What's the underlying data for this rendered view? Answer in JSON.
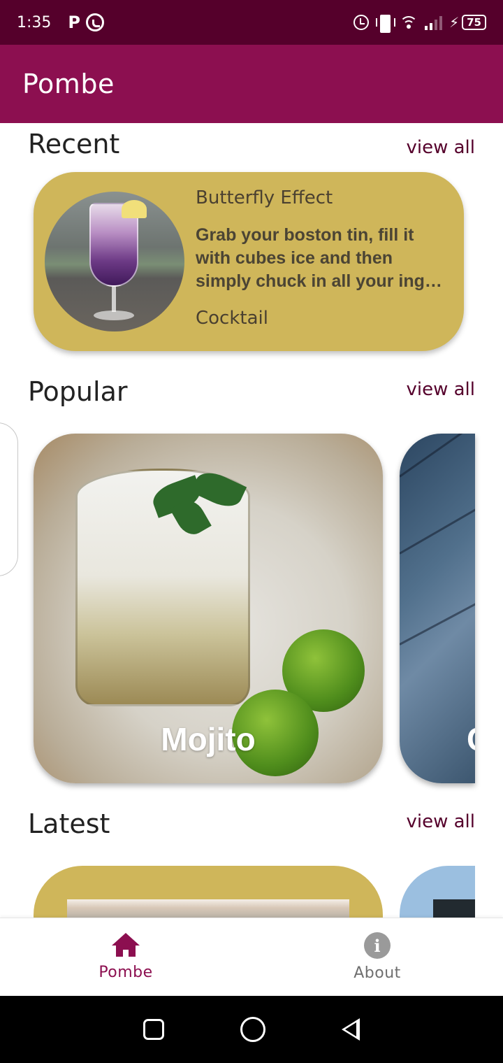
{
  "status_bar": {
    "time": "1:35",
    "left_icons": [
      "p-icon",
      "whatsapp-icon"
    ],
    "right_icons": [
      "alarm-icon",
      "vibrate-icon",
      "wifi-icon",
      "signal-icon",
      "charging-icon"
    ],
    "battery_level": "75",
    "background": "#55002b"
  },
  "app_bar": {
    "title": "Pombe",
    "background": "#8c0f50"
  },
  "sections": {
    "recent": {
      "title": "Recent",
      "view_all": "view all"
    },
    "popular": {
      "title": "Popular",
      "view_all": "view all"
    },
    "latest": {
      "title": "Latest",
      "view_all": "view all"
    }
  },
  "recent_card": {
    "name": "Butterfly Effect",
    "description": "Grab your boston tin, fill it with cubes ice and then simply chuck in all your ing…",
    "category": "Cocktail",
    "background": "#cfb65a"
  },
  "popular_cards": [
    {
      "title": "Mojito"
    },
    {
      "title": "C"
    }
  ],
  "bottom_nav": {
    "items": [
      {
        "label": "Pombe",
        "icon": "home-icon",
        "active": true
      },
      {
        "label": "About",
        "icon": "info-icon",
        "active": false
      }
    ],
    "active_color": "#8c0f50"
  },
  "system_nav": {
    "icons": [
      "recents-icon",
      "home-circle-icon",
      "back-icon"
    ]
  },
  "colors": {
    "accent": "#8c0f50",
    "card": "#cfb65a",
    "link": "#55002b"
  }
}
